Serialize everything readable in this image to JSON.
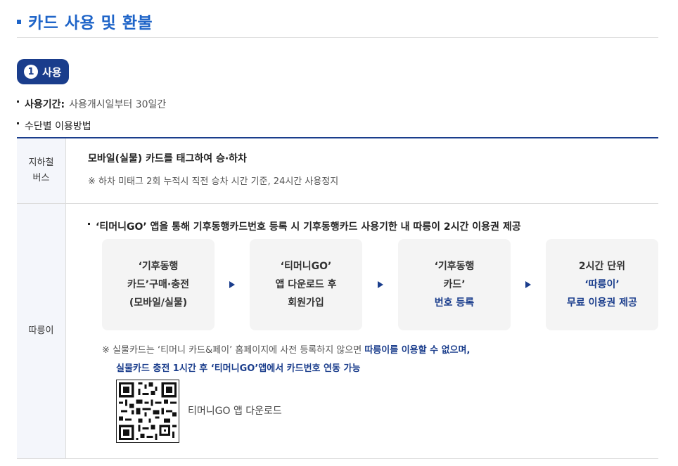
{
  "section": {
    "title": "카드 사용 및 환불"
  },
  "step": {
    "number": "1",
    "label": "사용"
  },
  "period": {
    "label": "사용기간:",
    "value": "사용개시일부터 30일간"
  },
  "method": {
    "label": "수단별 이용방법"
  },
  "rows": {
    "subway_bus": {
      "head_line1": "지하철",
      "head_line2": "버스",
      "main": "모바일(실물) 카드를 태그하여 승·하차",
      "note": "※ 하차 미태그 2회 누적시 직전 승차 시간 기준, 24시간 사용정지"
    },
    "ttareungi": {
      "head": "따릉이",
      "bullet": "‘티머니GO’ 앱을 통해 기후동행카드번호 등록 시 기후동행카드 사용기한 내 따릉이 2시간 이용권 제공",
      "steps": [
        {
          "l1": "‘기후동행",
          "l2": "카드’구매·충전",
          "l3": "(모바일/실물)"
        },
        {
          "l1": "‘티머니GO’",
          "l2": "앱 다운로드 후",
          "l3": "회원가입"
        },
        {
          "l1": "‘기후동행",
          "l2": "카드’",
          "l3": "번호 등록"
        },
        {
          "l1": "2시간 단위",
          "l2": "‘따릉이’",
          "l3": "무료 이용권 제공"
        }
      ],
      "note_prefix": "※ 실물카드는 ‘티머니 카드&페이’ 홈페이지에 사전 등록하지 않으면 ",
      "note_blue": "따릉이를 이용할 수 없으며,",
      "note_line2": "실물카드 충전 1시간 후 ‘티머니GO’앱에서 카드번호 연동 가능",
      "qr_label": "티머니GO 앱 다운로드"
    }
  }
}
